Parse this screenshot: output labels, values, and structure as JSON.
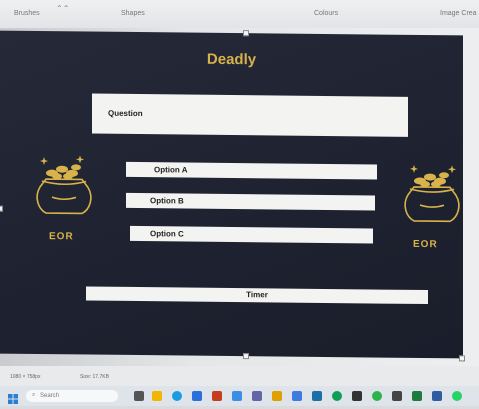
{
  "toolbar": {
    "brushes_label": "Brushes",
    "shapes_label": "Shapes",
    "colours_label": "Colours",
    "image_creator_label": "Image Crea"
  },
  "slide": {
    "title": "Deadly",
    "question_label": "Question",
    "options": [
      "Option A",
      "Option B",
      "Option C"
    ],
    "timer_label": "Timer",
    "logo_text": "EOR"
  },
  "statusbar": {
    "dimensions": "1080 × 758px",
    "size": "Size: 17.7KB"
  },
  "taskbar": {
    "search_placeholder": "Search"
  },
  "colors": {
    "slide_bg": "#1e2230",
    "accent_gold": "#d8b24a",
    "box_bg": "#f3f3f1"
  }
}
